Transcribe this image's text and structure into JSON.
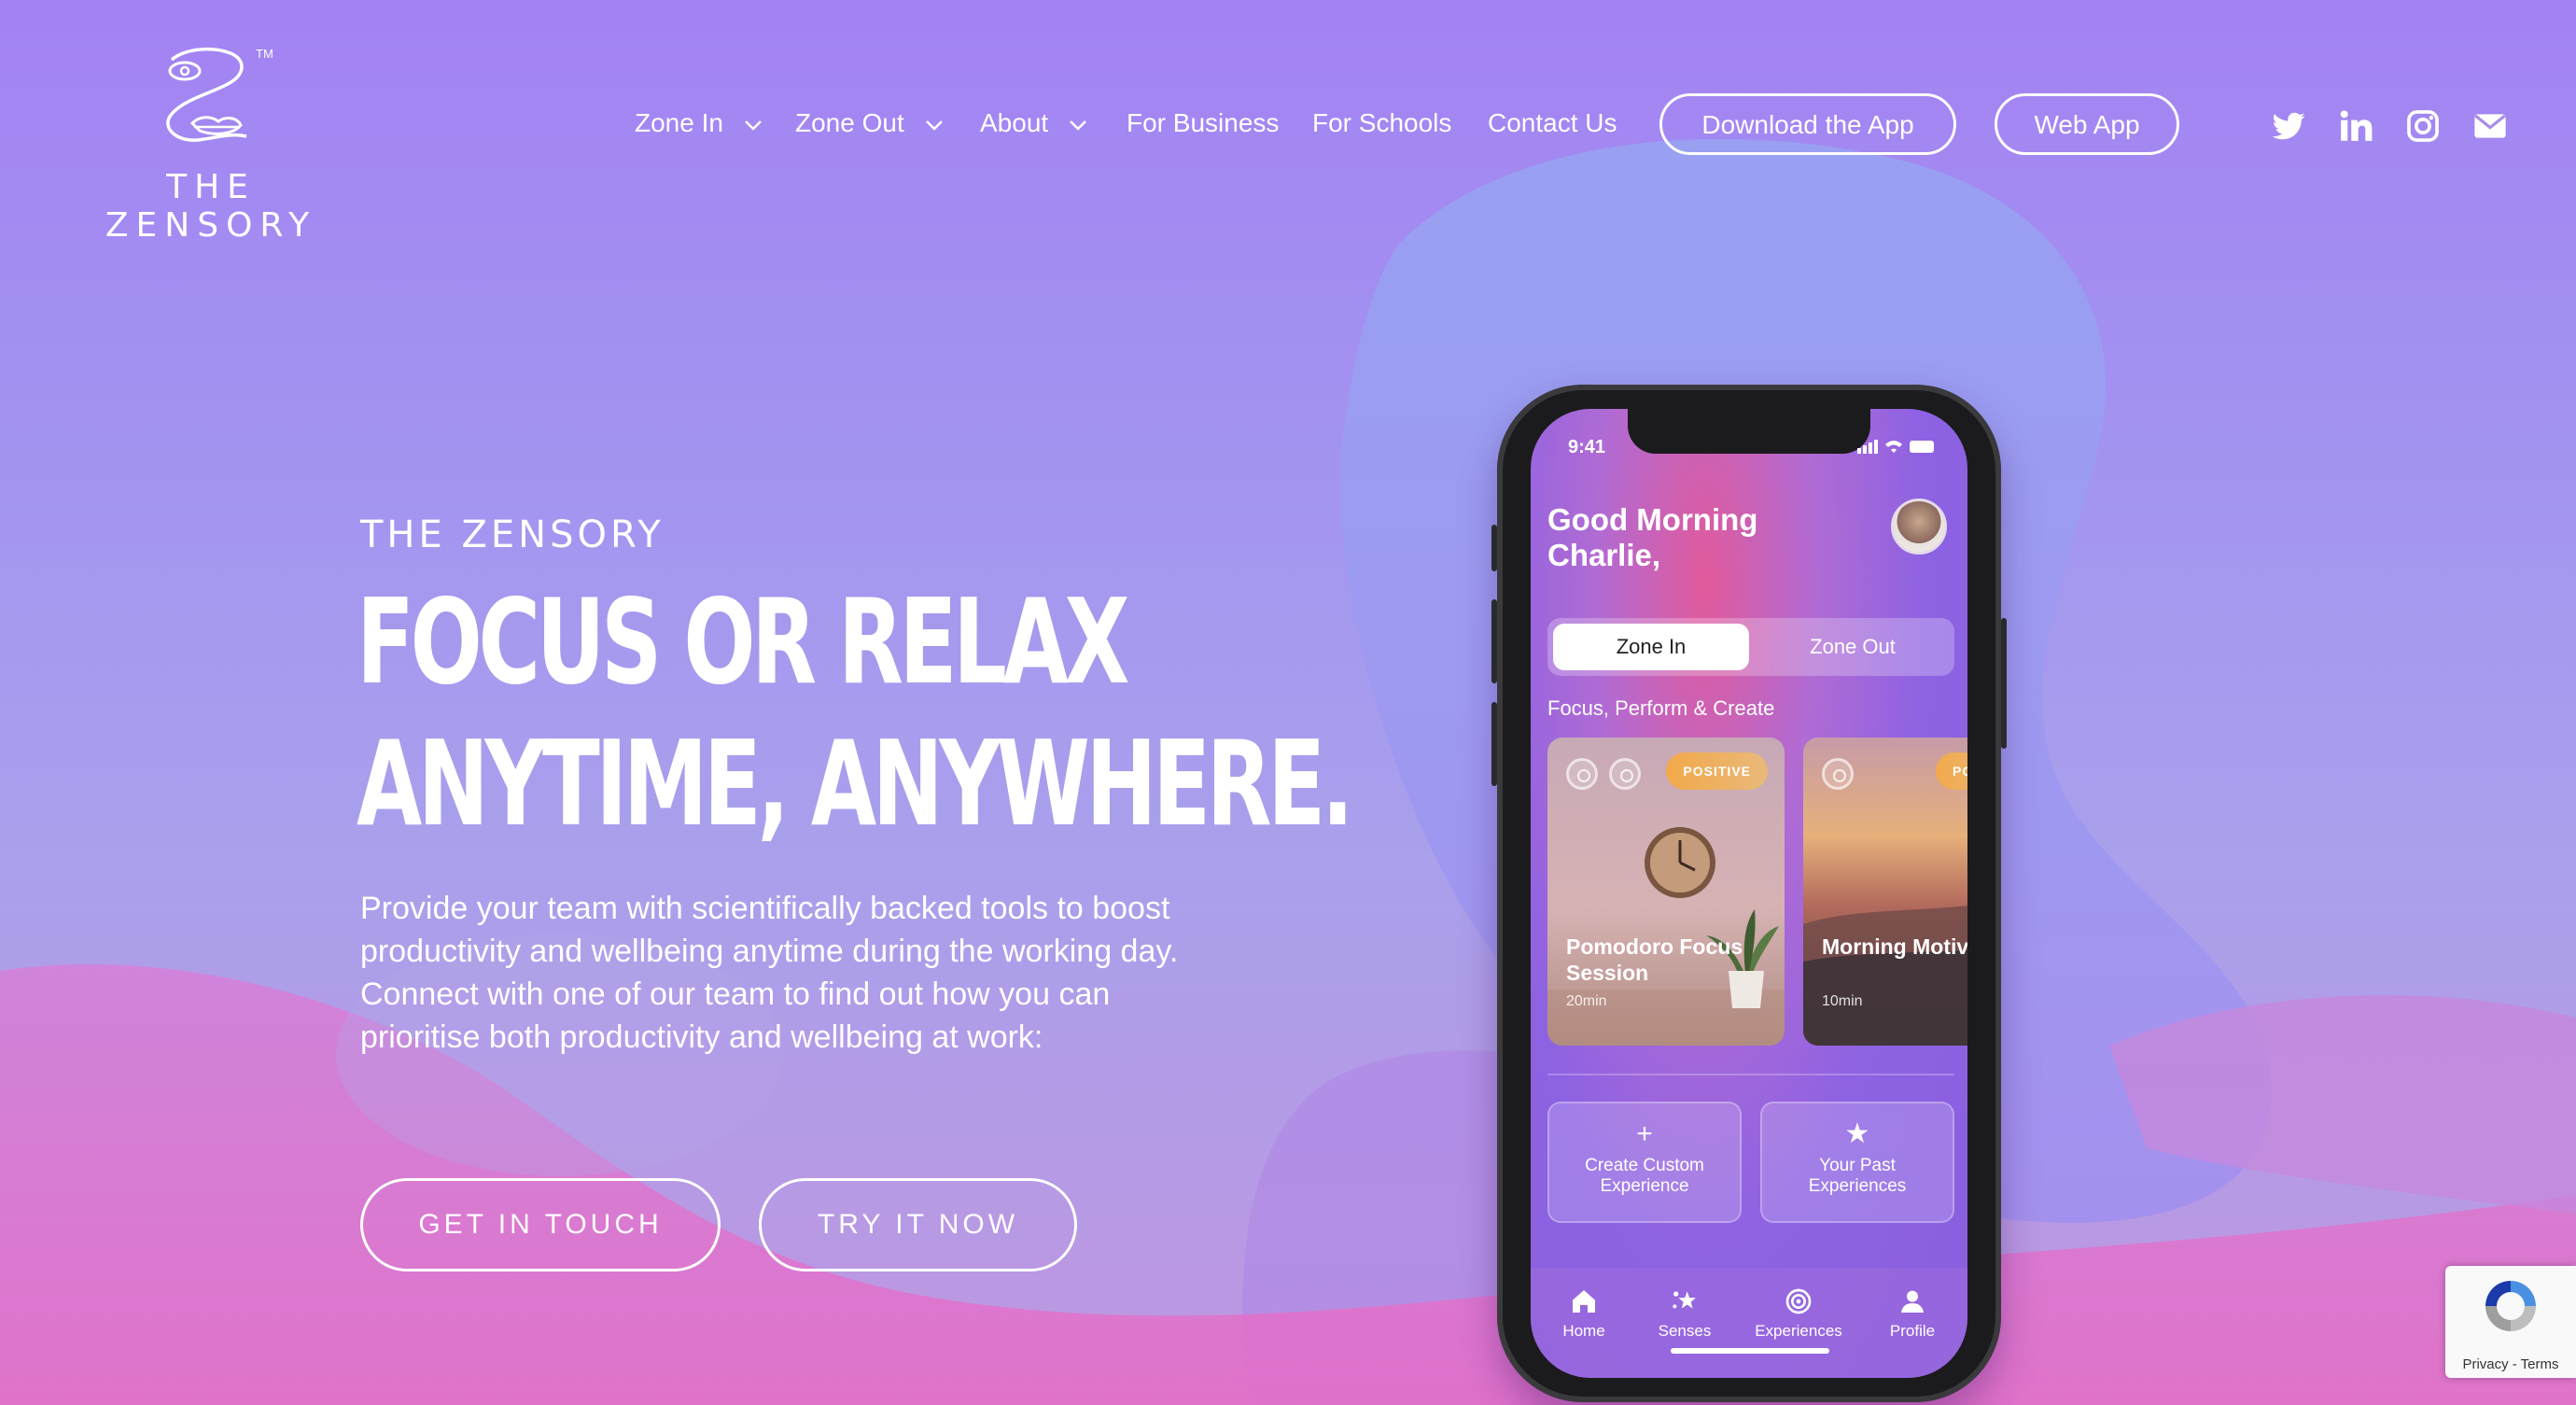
{
  "brand": {
    "name": "THE ZENSORY",
    "trademark": "TM"
  },
  "nav": {
    "items": [
      {
        "label": "Zone In",
        "has_dropdown": true
      },
      {
        "label": "Zone Out",
        "has_dropdown": true
      },
      {
        "label": "About",
        "has_dropdown": true
      },
      {
        "label": "For Business",
        "has_dropdown": false
      },
      {
        "label": "For Schools",
        "has_dropdown": false
      },
      {
        "label": "Contact Us",
        "has_dropdown": false
      }
    ],
    "download_label": "Download the App",
    "webapp_label": "Web App",
    "social": [
      "twitter-icon",
      "linkedin-icon",
      "instagram-icon",
      "email-icon"
    ]
  },
  "hero": {
    "eyebrow": "THE ZENSORY",
    "headline_line1": "FOCUS OR RELAX",
    "headline_line2": "ANYTIME, ANYWHERE.",
    "body_line1": "Provide your team with scientifically backed tools to boost productivity and wellbeing anytime during the working day.",
    "body_line2": "Connect with one of our team to find out how you can prioritise both productivity and wellbeing at work:",
    "cta_primary": "GET IN TOUCH",
    "cta_secondary": "TRY IT NOW"
  },
  "phone": {
    "time": "9:41",
    "greeting": "Good Morning Charlie,",
    "segment_active": "Zone In",
    "segment_inactive": "Zone Out",
    "section_heading": "Focus, Perform & Create",
    "cards": [
      {
        "title": "Pomodoro Focus Session",
        "duration": "20min",
        "badge": "POSITIVE"
      },
      {
        "title": "Morning Motivation",
        "duration": "10min",
        "badge": "POS"
      }
    ],
    "tiles": [
      {
        "icon": "plus-icon",
        "label": "Create Custom Experience"
      },
      {
        "icon": "star-icon",
        "label": "Your Past Experiences"
      }
    ],
    "tabs": [
      {
        "icon": "home-icon",
        "label": "Home"
      },
      {
        "icon": "senses-icon",
        "label": "Senses"
      },
      {
        "icon": "experiences-icon",
        "label": "Experiences"
      },
      {
        "icon": "profile-icon",
        "label": "Profile"
      }
    ]
  },
  "recaptcha": {
    "links": "Privacy - Terms"
  },
  "colors": {
    "bg_top": "#a382f3",
    "bg_bottom": "#e070c8",
    "text": "#ffffff"
  }
}
